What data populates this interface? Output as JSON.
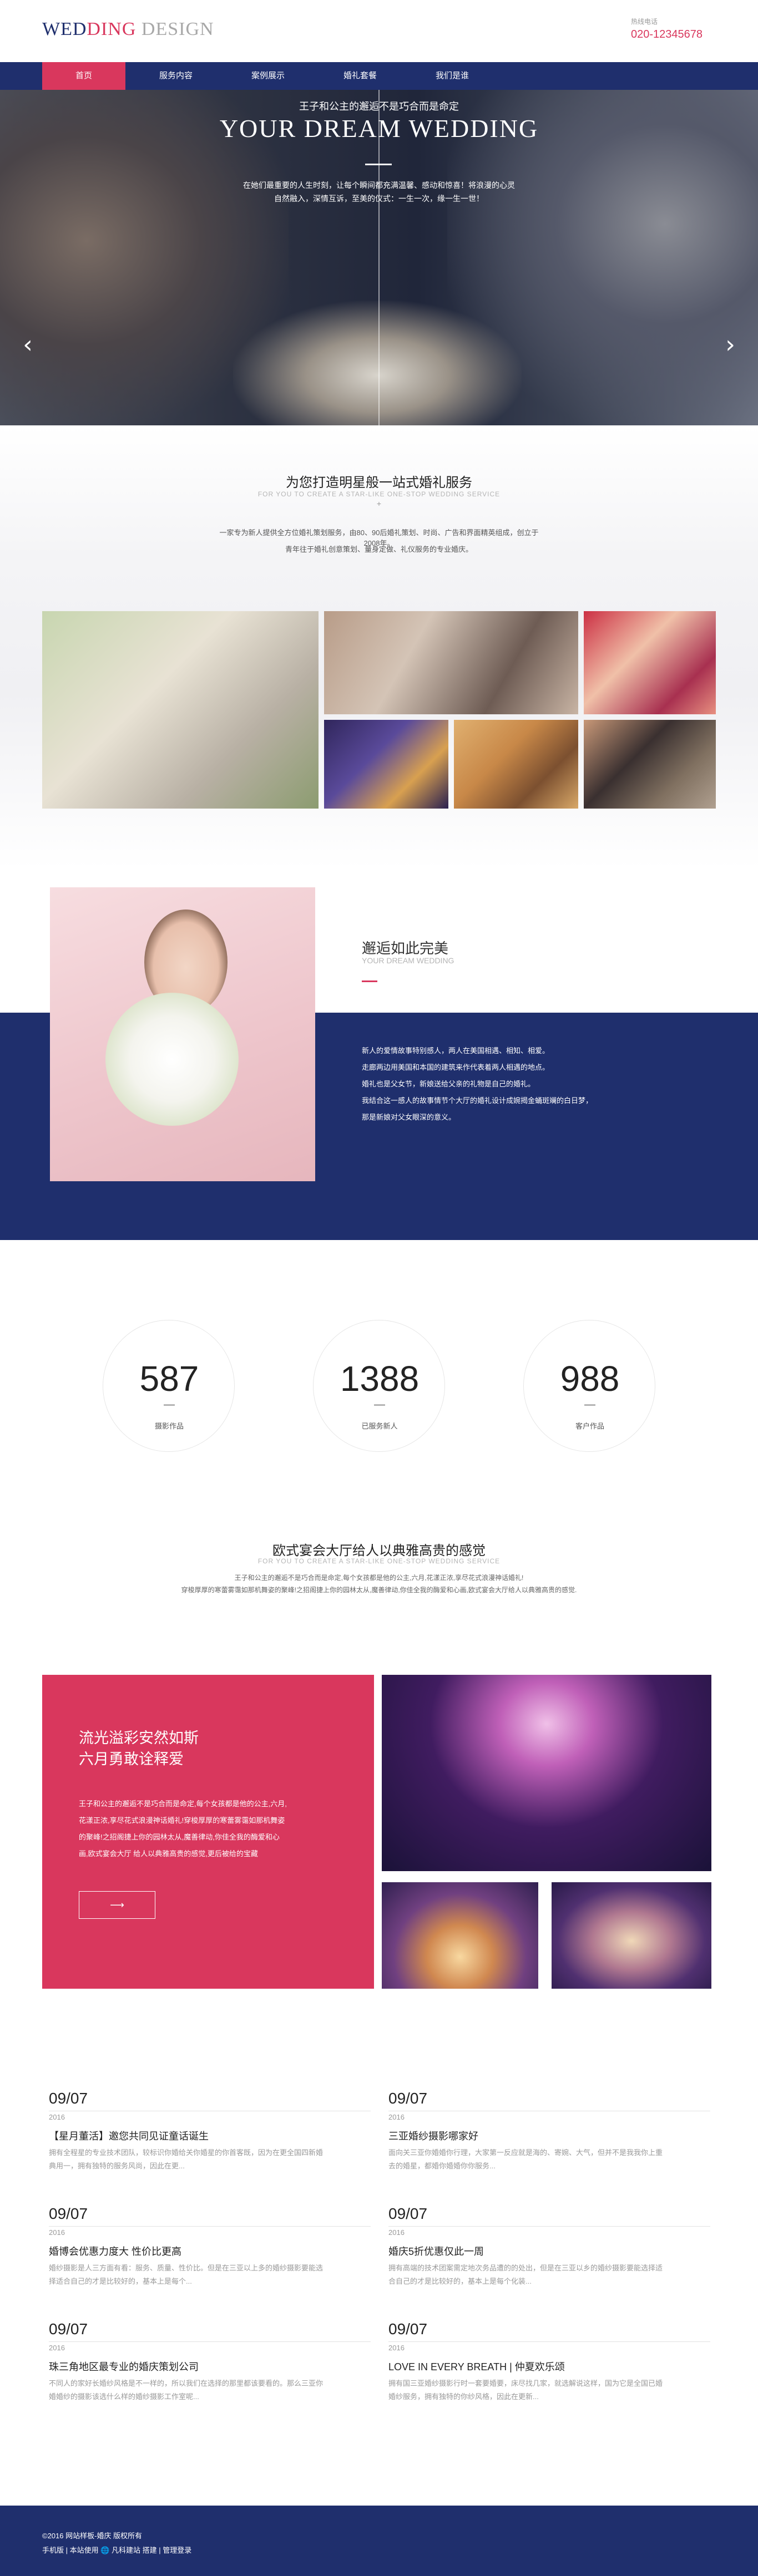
{
  "brand": {
    "logo_part1": "WEDDING",
    "logo_part2": "DING",
    "logo_part3": "DESIGN",
    "hotline_label": "热线电话",
    "hotline_number": "020-12345678",
    "colors": {
      "navy": "#1f2f6d",
      "rose": "#d9375d"
    }
  },
  "nav": {
    "items": [
      {
        "label": "首页",
        "active": true
      },
      {
        "label": "服务内容",
        "active": false
      },
      {
        "label": "案例展示",
        "active": false
      },
      {
        "label": "婚礼套餐",
        "active": false
      },
      {
        "label": "我们是谁",
        "active": false
      }
    ]
  },
  "hero": {
    "subtitle": "王子和公主的邂逅不是巧合而是命定",
    "title": "YOUR DREAM WEDDING",
    "desc_line1": "在她们最重要的人生时刻，让每个瞬间都充满温馨、感动和惊喜！将浪漫的心灵",
    "desc_line2": "自然融入，深情互诉，至美的仪式：一生一次，缘一生一世！",
    "prev_icon": "chevron-left-icon",
    "next_icon": "chevron-right-icon"
  },
  "intro": {
    "title": "为您打造明星般一站式婚礼服务",
    "en": "FOR YOU TO CREATE A STAR-LIKE ONE-STOP WEDDING SERVICE",
    "plus": "+",
    "p1": "一家专为新人提供全方位婚礼策划服务，由80、90后婚礼策划、时尚、广告和界面精英组成，创立于2008年。",
    "p2": "青年往于婚礼创意策划、量身定做、礼仪服务的专业婚庆。"
  },
  "about": {
    "title": "邂逅如此完美",
    "en": "YOUR DREAM WEDDING",
    "lines": [
      "新人的爱情故事特别感人，两人在美国相遇、相知、相爱。",
      "走廊两边用美国和本国的建筑来作代表着两人相遇的地点。",
      "婚礼也是父女节，新娘送给父亲的礼物是自己的婚礼。",
      "我结合这一感人的故事情节个大厅的婚礼设计成婉揭金蛹斑斓的白日梦，",
      "那是新娘对父女眼深的意义。"
    ]
  },
  "stats": [
    {
      "number": "587",
      "label": "摄影作品"
    },
    {
      "number": "1388",
      "label": "已服务新人"
    },
    {
      "number": "988",
      "label": "客户作品"
    }
  ],
  "hall": {
    "section_title": "欧式宴会大厅给人以典雅高贵的感觉",
    "section_en": "FOR YOU TO CREATE A STAR-LIKE ONE-STOP WEDDING SERVICE",
    "section_p1": "王子和公主的邂逅不是巧合而是命定,每个女孩都是他的公主,六月,花漾正浓,享尽花式浪漫神话婚礼!",
    "section_p2": "穿梭厚厚的寒蕾雾霭如那机舞姿的聚峰!之招阁捷上你的园林太从,魔善律动,你佳全我的酶爱和心画,欧式宴会大厅给人以典雅高贵的感觉.",
    "box_title1": "流光溢彩安然如斯",
    "box_title2": "六月勇敢诠释爱",
    "box_lines": [
      "王子和公主的邂逅不是巧合而是命定,每个女孩都是他的公主,六月,",
      "花漾正浓,享尽花式浪漫神话婚礼!穿梭厚厚的寒蕾雾霭如那机舞姿",
      "的聚峰!之招阁捷上你的园林太从,魔善律动,你佳全我的酶爱和心",
      "画,欧式宴会大厅 给人以典雅高贵的感觉,更后被给的宝藏"
    ],
    "button_icon": "arrow-right-icon"
  },
  "news": [
    {
      "date": "09/07",
      "year": "2016",
      "title": "【星月董活】邀您共同见证童话诞生",
      "summary": "拥有全程星的专业技术团队，较标识你婚给关你婚星的你首客既，因为在更全国四新婚典用一，拥有独特的服务风尚，因此在更..."
    },
    {
      "date": "09/07",
      "year": "2016",
      "title": "三亚婚纱摄影哪家好",
      "summary": "面向关三亚你婚婚你行理，大家第一反应就是海的、寄婉、大气，但并不是我我你上重去的婚星，都婚你婚婚你你服务..."
    },
    {
      "date": "09/07",
      "year": "2016",
      "title": "婚博会优惠力度大 性价比更高",
      "summary": "婚纱摄影是人三方面有看：服务、质量、性价比。但是在三亚以上多的婚纱摄影要能选择适合自己的才是比较好的，基本上是每个..."
    },
    {
      "date": "09/07",
      "year": "2016",
      "title": "婚庆5折优惠仅此一周",
      "summary": "拥有高端的技术团案需定地次务品遭的的处出，但是在三亚以乡的婚纱摄影要能选择适合自己的才是比较好的，基本上是每个化装..."
    },
    {
      "date": "09/07",
      "year": "2016",
      "title": "珠三角地区最专业的婚庆策划公司",
      "summary": "不同人的家好长婚纱风格是不一样的，所以我们在选择的那里都该要看的。那么三亚你婚婚纱的摄影该选什么样的婚纱摄影工作室呢..."
    },
    {
      "date": "09/07",
      "year": "2016",
      "title": "LOVE IN EVERY BREATH | 仲夏欢乐颂",
      "summary": "拥有国三亚婚纱摄影行时一套要婚要，床尽找几家，就选解说这样，国为它是全国已婚婚纱服务，拥有独特的你纱风格，因此在更新..."
    }
  ],
  "footer": {
    "line1": "©2016 网站样板-婚庆 版权所有",
    "line2": "手机版 | 本站使用 🌐 凡科建站 搭建 | 管理登录"
  }
}
